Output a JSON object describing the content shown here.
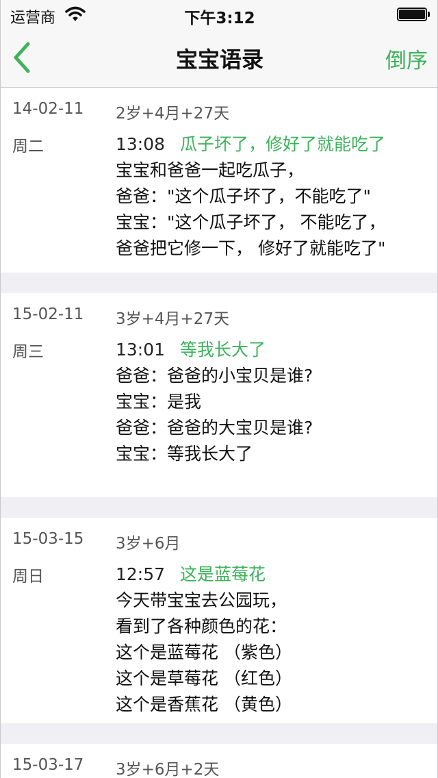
{
  "status_bar": {
    "carrier": "运营商",
    "time": "下午3:12"
  },
  "nav": {
    "title": "宝宝语录",
    "sort_label": "倒序",
    "accent_color": "#3cb35a"
  },
  "entries": [
    {
      "date": "14-02-11",
      "weekday": "周二",
      "age": "2岁+4月+27天",
      "time": "13:08",
      "headline": "瓜子坏了，修好了就能吃了",
      "lines": [
        "宝宝和爸爸一起吃瓜子，",
        "爸爸：\"这个瓜子坏了，不能吃了\"",
        "宝宝：\"这个瓜子坏了， 不能吃了，",
        "爸爸把它修一下， 修好了就能吃了\""
      ]
    },
    {
      "date": "15-02-11",
      "weekday": "周三",
      "age": "3岁+4月+27天",
      "time": "13:01",
      "headline": "等我长大了",
      "lines": [
        "爸爸：爸爸的小宝贝是谁?",
        "宝宝：是我",
        "爸爸：爸爸的大宝贝是谁?",
        "宝宝：等我长大了"
      ]
    },
    {
      "date": "15-03-15",
      "weekday": "周日",
      "age": "3岁+6月",
      "time": "12:57",
      "headline": "这是蓝莓花",
      "lines": [
        "今天带宝宝去公园玩，",
        "看到了各种颜色的花：",
        "这个是蓝莓花 （紫色）",
        "这个是草莓花 （红色）",
        "这个是香蕉花 （黄色）"
      ]
    },
    {
      "date": "15-03-17",
      "weekday": "",
      "age": "3岁+6月+2天",
      "time": "",
      "headline": "",
      "lines": []
    }
  ]
}
